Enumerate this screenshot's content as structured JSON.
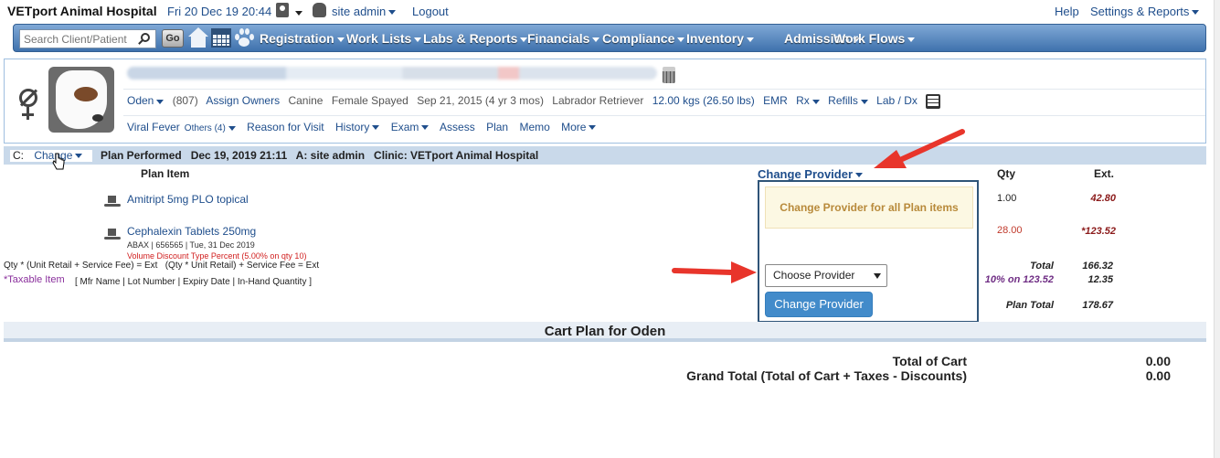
{
  "header": {
    "app_title": "VETport Animal Hospital",
    "datetime": "Fri 20 Dec 19 20:44",
    "user_name": "site admin",
    "logout": "Logout",
    "help": "Help",
    "settings": "Settings & Reports"
  },
  "nav": {
    "search_placeholder": "Search Client/Patient",
    "go": "Go",
    "items": [
      "Registration",
      "Work Lists",
      "Labs & Reports",
      "Financials",
      "Compliance",
      "Inventory",
      "Admission",
      "Work Flows"
    ]
  },
  "patient": {
    "name": "Oden",
    "id": "(807)",
    "assign_owners": "Assign Owners",
    "species": "Canine",
    "sex": "Female Spayed",
    "dob": "Sep 21, 2015 (4 yr 3 mos)",
    "breed": "Labrador Retriever",
    "weight": "12.00 kgs (26.50 lbs)",
    "emr": "EMR",
    "rx": "Rx",
    "refills": "Refills",
    "lab": "Lab / Dx",
    "row3": {
      "problem": "Viral Fever",
      "others": "Others (4)",
      "reason": "Reason for Visit",
      "history": "History",
      "exam": "Exam",
      "assess": "Assess",
      "plan": "Plan",
      "memo": "Memo",
      "more": "More"
    }
  },
  "plan_bar": {
    "c_label": "C:",
    "change": "Change",
    "info": "Plan Performed   Dec 19, 2019 21:11   A: site admin   Clinic: VETport Animal Hospital"
  },
  "table": {
    "headers": {
      "plan_item": "Plan Item",
      "provider": "Change Provider",
      "qty": "Qty",
      "ext": "Ext."
    },
    "items": [
      {
        "name": "Amitript 5mg PLO topical",
        "qty": "1.00",
        "ext": "42.80"
      },
      {
        "name": "Cephalexin Tablets 250mg",
        "detail": "ABAX | 656565 | Tue, 31 Dec 2019",
        "discount": "Volume Discount Type Percent (5.00% on qty 10)",
        "qty": "28.00",
        "ext": "*123.52"
      }
    ],
    "formula": "Qty * (Unit Retail + Service Fee) = Ext   (Qty * Unit Retail) + Service Fee = Ext",
    "formula_ext": "Ext",
    "taxable_legend": "Taxable Item",
    "taxable_detail": "[ Mfr Name | Lot Number | Expiry Date | In-Hand Quantity ]",
    "total_label": "Total",
    "total_value": "166.32",
    "discount_label": "10% on 123.52",
    "discount_value": "12.35",
    "plan_total_label": "Plan Total",
    "plan_total_value": "178.67"
  },
  "popup": {
    "info": "Change Provider for all Plan items",
    "select_value": "Choose Provider",
    "button": "Change Provider"
  },
  "cart": {
    "title": "Cart Plan for Oden",
    "total_label": "Total of Cart",
    "total_value": "0.00",
    "grand_label": "Grand Total (Total of Cart + Taxes - Discounts)",
    "grand_value": "0.00"
  },
  "colors": {
    "accent": "#428bca",
    "arrow": "#e8352b",
    "nav": "#3f72ad"
  }
}
